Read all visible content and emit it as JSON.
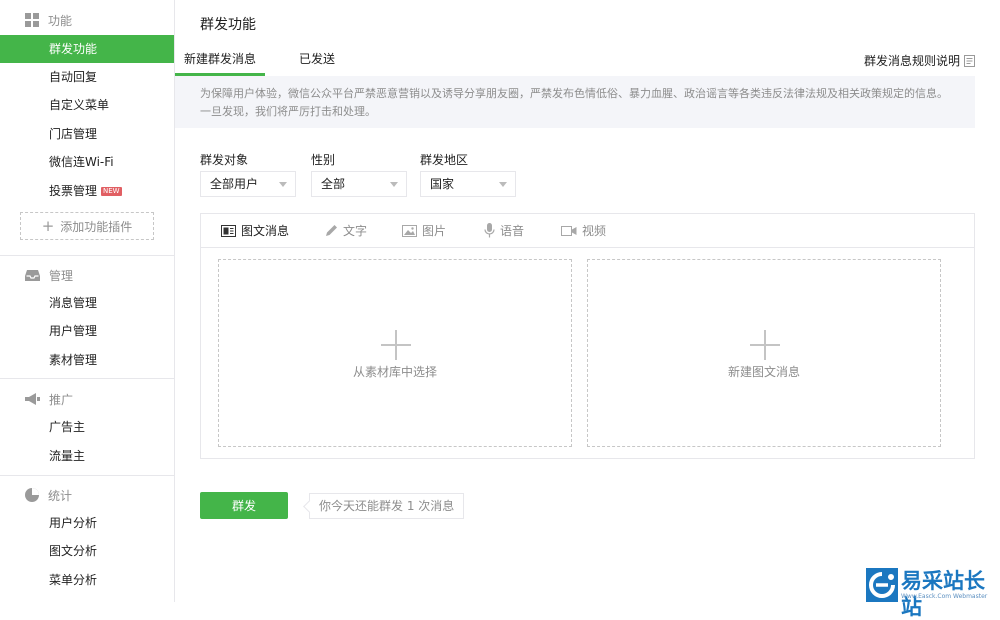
{
  "sidebar": {
    "groups": [
      {
        "title": "功能",
        "icon": "grid-icon",
        "items": [
          {
            "label": "群发功能",
            "active": true
          },
          {
            "label": "自动回复"
          },
          {
            "label": "自定义菜单"
          },
          {
            "label": "门店管理"
          },
          {
            "label": "微信连Wi-Fi"
          },
          {
            "label": "投票管理",
            "badge": "NEW"
          }
        ],
        "add_plugin": "添加功能插件"
      },
      {
        "title": "管理",
        "icon": "inbox-icon",
        "items": [
          {
            "label": "消息管理"
          },
          {
            "label": "用户管理"
          },
          {
            "label": "素材管理"
          }
        ]
      },
      {
        "title": "推广",
        "icon": "megaphone-icon",
        "items": [
          {
            "label": "广告主"
          },
          {
            "label": "流量主"
          }
        ]
      },
      {
        "title": "统计",
        "icon": "pie-chart-icon",
        "items": [
          {
            "label": "用户分析"
          },
          {
            "label": "图文分析"
          },
          {
            "label": "菜单分析"
          }
        ]
      }
    ]
  },
  "main": {
    "title": "群发功能",
    "tabs": [
      {
        "label": "新建群发消息",
        "active": true
      },
      {
        "label": "已发送"
      }
    ],
    "rules_link": "群发消息规则说明",
    "notice": "为保障用户体验，微信公众平台严禁恶意营销以及诱导分享朋友圈，严禁发布色情低俗、暴力血腥、政治谣言等各类违反法律法规及相关政策规定的信息。一旦发现，我们将严厉打击和处理。",
    "filters": [
      {
        "label": "群发对象",
        "value": "全部用户"
      },
      {
        "label": "性别",
        "value": "全部"
      },
      {
        "label": "群发地区",
        "value": "国家"
      }
    ],
    "message_types": [
      {
        "label": "图文消息",
        "icon": "news-icon",
        "active": true
      },
      {
        "label": "文字",
        "icon": "pencil-icon"
      },
      {
        "label": "图片",
        "icon": "image-icon"
      },
      {
        "label": "语音",
        "icon": "microphone-icon"
      },
      {
        "label": "视频",
        "icon": "video-icon"
      }
    ],
    "cards": [
      {
        "label": "从素材库中选择"
      },
      {
        "label": "新建图文消息"
      }
    ],
    "send_button": "群发",
    "quota_text": "你今天还能群发 1 次消息"
  },
  "watermark": {
    "text": "易采站长站",
    "sub": "Www.Easck.Com Webmaster"
  },
  "colors": {
    "accent": "#44b549",
    "badge": "#e15f63",
    "watermark": "#1b77c0"
  }
}
